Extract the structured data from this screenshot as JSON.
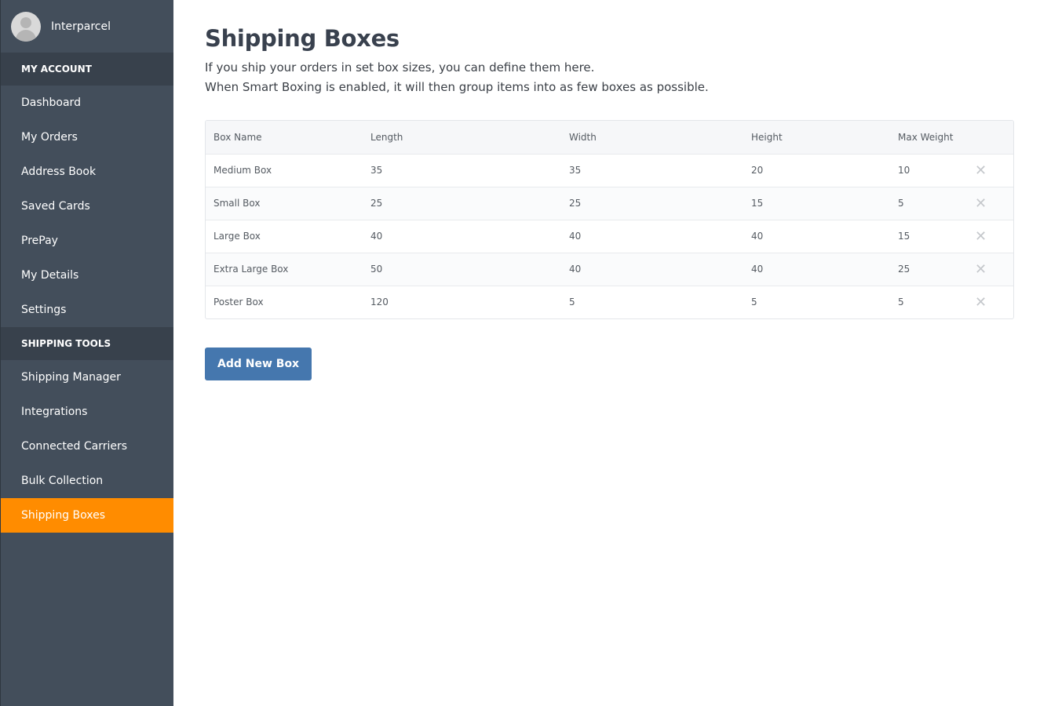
{
  "user": {
    "name": "Interparcel"
  },
  "sidebar": {
    "sections": [
      {
        "title": "MY ACCOUNT",
        "items": [
          {
            "label": "Dashboard"
          },
          {
            "label": "My Orders"
          },
          {
            "label": "Address Book"
          },
          {
            "label": "Saved Cards"
          },
          {
            "label": "PrePay"
          },
          {
            "label": "My Details"
          },
          {
            "label": "Settings"
          }
        ]
      },
      {
        "title": "SHIPPING TOOLS",
        "items": [
          {
            "label": "Shipping Manager"
          },
          {
            "label": "Integrations"
          },
          {
            "label": "Connected Carriers"
          },
          {
            "label": "Bulk Collection"
          },
          {
            "label": "Shipping Boxes",
            "active": true
          }
        ]
      }
    ],
    "active_color": "#ff8c00"
  },
  "page": {
    "title": "Shipping Boxes",
    "description_line1": "If you ship your orders in set box sizes, you can define them here.",
    "description_line2": "When Smart Boxing is enabled, it will then group items into as few boxes as possible."
  },
  "table": {
    "headers": {
      "name": "Box Name",
      "length": "Length",
      "width": "Width",
      "height": "Height",
      "max_weight": "Max Weight"
    },
    "rows": [
      {
        "name": "Medium Box",
        "length": "35",
        "width": "35",
        "height": "20",
        "max_weight": "10"
      },
      {
        "name": "Small Box",
        "length": "25",
        "width": "25",
        "height": "15",
        "max_weight": "5"
      },
      {
        "name": "Large Box",
        "length": "40",
        "width": "40",
        "height": "40",
        "max_weight": "15"
      },
      {
        "name": "Extra Large Box",
        "length": "50",
        "width": "40",
        "height": "40",
        "max_weight": "25"
      },
      {
        "name": "Poster Box",
        "length": "120",
        "width": "5",
        "height": "5",
        "max_weight": "5"
      }
    ],
    "delete_icon": "close-icon"
  },
  "actions": {
    "add_label": "Add New Box",
    "button_color": "#4577ae"
  }
}
